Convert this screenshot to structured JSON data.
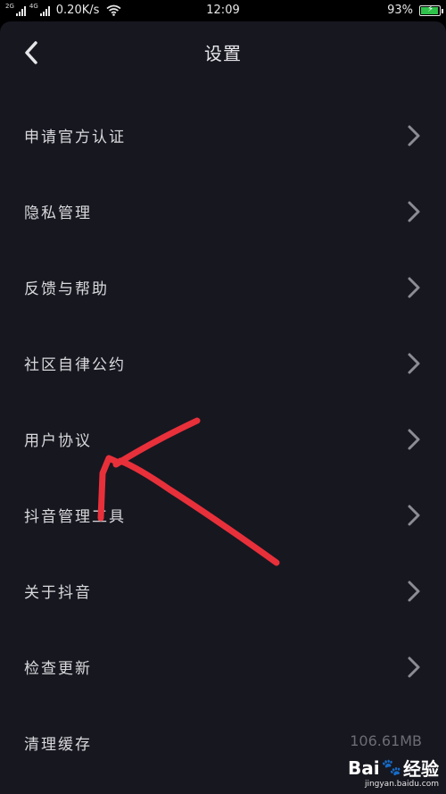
{
  "status_bar": {
    "network_tag_1": "2G",
    "network_tag_2": "4G",
    "speed": "0.20K/s",
    "time": "12:09",
    "battery": "93%",
    "battery_level": 0.93,
    "battery_color": "#2fc24a"
  },
  "nav": {
    "back_icon": "chevron-left-icon",
    "title": "设置"
  },
  "menu": {
    "items": [
      {
        "label": "申请官方认证",
        "icon": "chevron-right-icon"
      },
      {
        "label": "隐私管理",
        "icon": "chevron-right-icon"
      },
      {
        "label": "反馈与帮助",
        "icon": "chevron-right-icon"
      },
      {
        "label": "社区自律公约",
        "icon": "chevron-right-icon"
      },
      {
        "label": "用户协议",
        "icon": "chevron-right-icon"
      },
      {
        "label": "抖音管理工具",
        "icon": "chevron-right-icon"
      },
      {
        "label": "关于抖音",
        "icon": "chevron-right-icon"
      },
      {
        "label": "检查更新",
        "icon": "chevron-right-icon"
      },
      {
        "label": "清理缓存",
        "value": "106.61MB"
      }
    ]
  },
  "annotation": {
    "type": "hand-drawn-arrow",
    "color": "#e8303a"
  },
  "watermark": {
    "logo": "Bai",
    "logo_paw": "🐾",
    "logo_suffix": "经验",
    "url": "jingyan.baidu.com"
  },
  "colors": {
    "background": "#171720",
    "text": "#d8d8dc",
    "chevron": "#8c8c94",
    "value_text": "#6c6c74"
  }
}
